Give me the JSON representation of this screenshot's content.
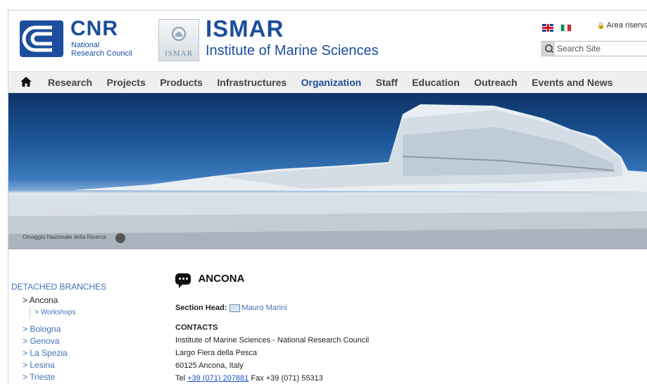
{
  "header": {
    "cnr_title": "CNR",
    "cnr_sub_1": "National",
    "cnr_sub_2": "Research Council",
    "ismar_logo_text": "ISMAR",
    "ismar_title": "ISMAR",
    "ismar_subtitle": "Institute of Marine Sciences",
    "area_label": "Area riservata",
    "search_placeholder": "Search Site",
    "brand_color": "#1b4e9c"
  },
  "nav": {
    "items": [
      {
        "label": "Research"
      },
      {
        "label": "Projects"
      },
      {
        "label": "Products"
      },
      {
        "label": "Infrastructures"
      },
      {
        "label": "Organization",
        "active": true
      },
      {
        "label": "Staff"
      },
      {
        "label": "Education"
      },
      {
        "label": "Outreach"
      },
      {
        "label": "Events and News"
      }
    ]
  },
  "hero": {
    "credit": "Omaggio Nazionale della Ricerca"
  },
  "sidebar": {
    "heading": "DETACHED BRANCHES",
    "items": [
      {
        "label": "> Ancona"
      },
      {
        "label": "> Workshops"
      },
      {
        "label": "> Bologna"
      },
      {
        "label": "> Genova"
      },
      {
        "label": "> La Spezia"
      },
      {
        "label": "> Lesina"
      },
      {
        "label": "> Trieste"
      }
    ]
  },
  "main": {
    "title": "ANCONA",
    "section_head_label": "Section Head:",
    "section_head_name": "Mauro Marini",
    "contacts_heading": "CONTACTS",
    "address_1": "Institute of Marine Sciences - National Research Council",
    "address_2": "Largo Fiera della Pesca",
    "address_3": "60125 Ancona, Italy",
    "tel_label": "Tel",
    "tel_number": "+39 (071) 207881",
    "fax_text": "Fax +39 (071) 55313"
  }
}
